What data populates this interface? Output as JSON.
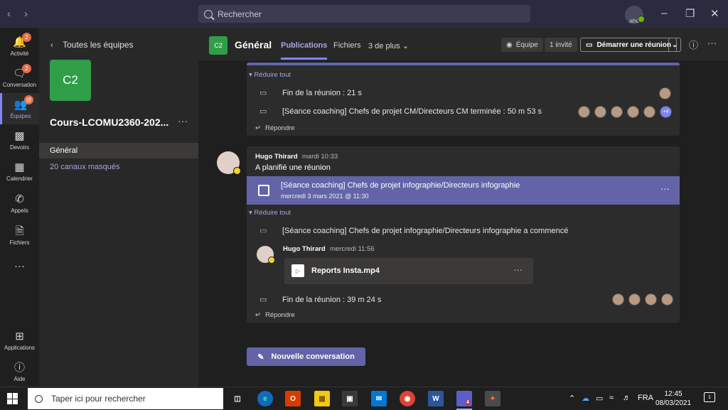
{
  "search": {
    "placeholder": "Rechercher"
  },
  "profile": {
    "initials": "ahc"
  },
  "rail": [
    {
      "label": "Activité",
      "icon": "bell-icon",
      "badge": "2"
    },
    {
      "label": "Conversation",
      "icon": "chat-icon",
      "badge": "2"
    },
    {
      "label": "Équipes",
      "icon": "teams-icon",
      "badge": "@"
    },
    {
      "label": "Devoirs",
      "icon": "backpack-icon"
    },
    {
      "label": "Calendrier",
      "icon": "calendar-icon"
    },
    {
      "label": "Appels",
      "icon": "phone-icon"
    },
    {
      "label": "Fichiers",
      "icon": "file-icon"
    },
    {
      "label": "",
      "icon": "more-icon"
    },
    {
      "label": "Applications",
      "icon": "apps-icon"
    },
    {
      "label": "Aide",
      "icon": "help-icon"
    }
  ],
  "team_panel": {
    "back_label": "Toutes les équipes",
    "avatar_text": "C2",
    "team_name": "Cours-LCOMU2360-202...",
    "channels": [
      "Général",
      "20 canaux masqués"
    ]
  },
  "header": {
    "avatar_text": "C2",
    "channel_name": "Général",
    "tabs": [
      "Publications",
      "Fichiers",
      "3 de plus"
    ],
    "team_button": "Équipe",
    "guest_button": "1 invité",
    "meeting_button": "Démarrer une réunion"
  },
  "feed": {
    "card1": {
      "collapse_label": "Réduire tout",
      "events": [
        {
          "text": "Fin de la réunion : 21 s"
        },
        {
          "text": "[Séance coaching] Chefs de projet CM/Directeurs CM terminée : 50 m 53 s",
          "more_count": "+4"
        }
      ],
      "reply_label": "Répondre"
    },
    "post2": {
      "author": "Hugo Thirard",
      "time": "mardi 10:33",
      "message": "A planifié une réunion",
      "meeting_title": "[Séance coaching] Chefs de projet infographie/Directeurs infographie",
      "meeting_date": "mercredi 3 mars 2021 @ 11:30",
      "collapse_label": "Réduire tout",
      "started_event": "[Séance coaching] Chefs de projet infographie/Directeurs infographie a commencé",
      "sub_author": "Hugo Thirard",
      "sub_time": "mercredi 11:56",
      "file_name": "Reports Insta.mp4",
      "end_event": "Fin de la réunion : 39 m 24 s",
      "reply_label": "Répondre"
    },
    "new_conversation": "Nouvelle conversation"
  },
  "taskbar": {
    "search_placeholder": "Taper ici pour rechercher",
    "language": "FRA",
    "time": "12:45",
    "date": "08/03/2021",
    "notification_count": "1",
    "teams_badge": "4"
  }
}
